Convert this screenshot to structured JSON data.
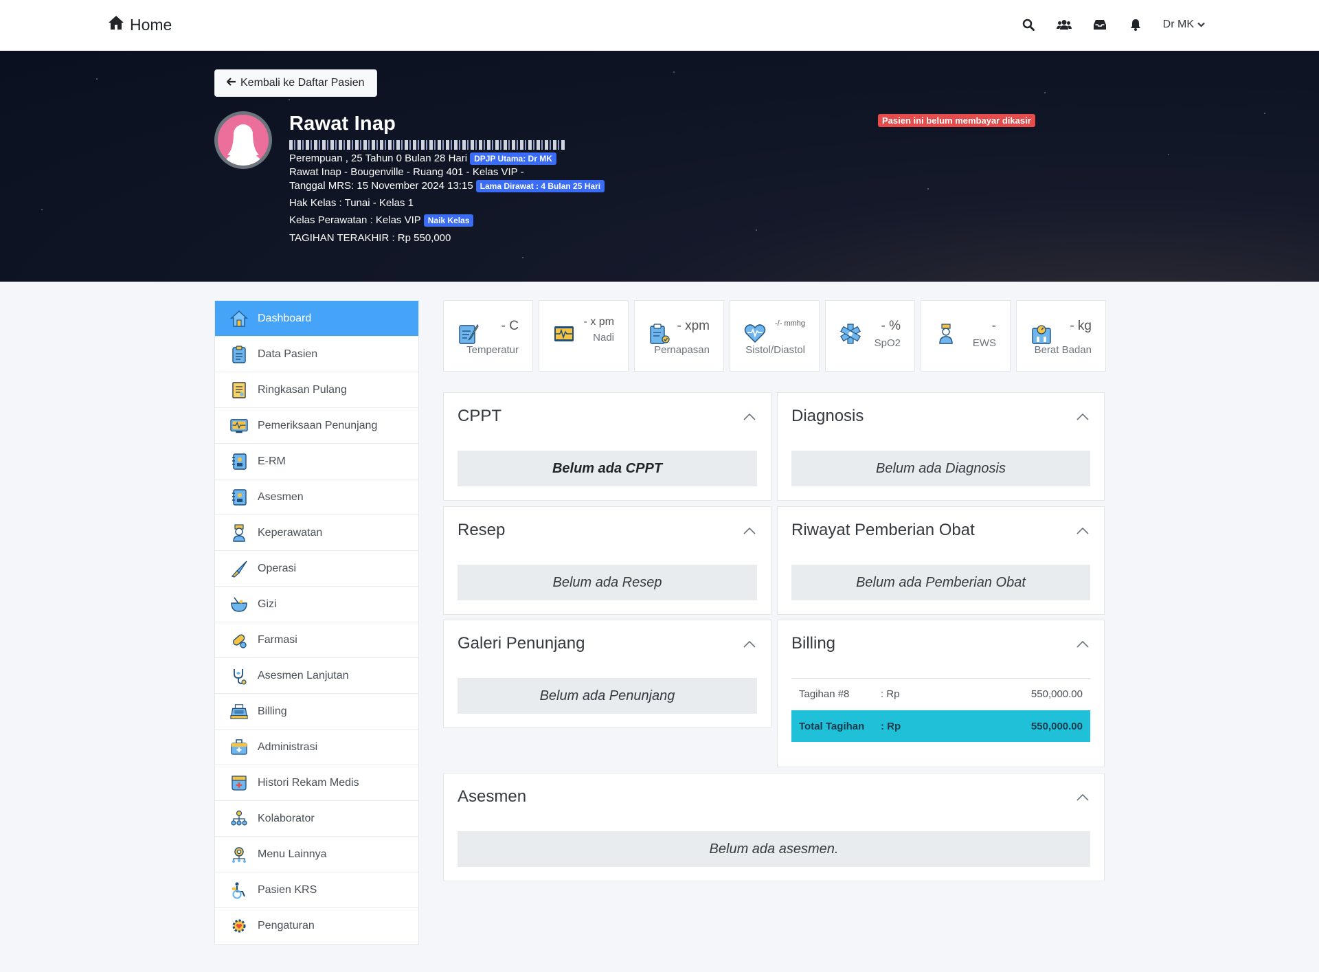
{
  "navbar": {
    "brand": "Home",
    "user": "Dr MK"
  },
  "hero": {
    "back_button": "Kembali ke Daftar Pasien",
    "title": "Rawat Inap",
    "gender_age": "Perempuan , 25 Tahun 0 Bulan 28 Hari",
    "dpjp_badge": "DPJP Utama: Dr MK",
    "room": "Rawat Inap - Bougenville - Ruang 401 - Kelas VIP -",
    "mrs_date": "Tanggal MRS: 15 November 2024 13:15",
    "length_badge": "Lama Dirawat : 4 Bulan 25 Hari",
    "hak_kelas": "Hak Kelas : Tunai - Kelas 1",
    "kelas_perawatan": "Kelas Perawatan : Kelas VIP",
    "naik_kelas_badge": "Naik Kelas",
    "tagihan": "TAGIHAN TERAKHIR : Rp 550,000",
    "alert": "Pasien ini belum membayar dikasir"
  },
  "sidebar": {
    "items": [
      {
        "label": "Dashboard",
        "icon": "home-icon"
      },
      {
        "label": "Data Pasien",
        "icon": "clipboard-icon"
      },
      {
        "label": "Ringkasan Pulang",
        "icon": "document-icon"
      },
      {
        "label": "Pemeriksaan Penunjang",
        "icon": "monitor-icon"
      },
      {
        "label": "E-RM",
        "icon": "notebook-icon"
      },
      {
        "label": "Asesmen",
        "icon": "notebook-icon"
      },
      {
        "label": "Keperawatan",
        "icon": "nurse-icon"
      },
      {
        "label": "Operasi",
        "icon": "scalpel-icon"
      },
      {
        "label": "Gizi",
        "icon": "bowl-icon"
      },
      {
        "label": "Farmasi",
        "icon": "pill-icon"
      },
      {
        "label": "Asesmen Lanjutan",
        "icon": "stethoscope-icon"
      },
      {
        "label": "Billing",
        "icon": "cash-register-icon"
      },
      {
        "label": "Administrasi",
        "icon": "medical-kit-icon"
      },
      {
        "label": "Histori Rekam Medis",
        "icon": "medical-box-icon"
      },
      {
        "label": "Kolaborator",
        "icon": "team-icon"
      },
      {
        "label": "Menu Lainnya",
        "icon": "gear-network-icon"
      },
      {
        "label": "Pasien KRS",
        "icon": "wheelchair-icon"
      },
      {
        "label": "Pengaturan",
        "icon": "settings-icon"
      }
    ]
  },
  "vitals": [
    {
      "value": "- C",
      "label": "Temperatur",
      "icon": "thermometer-icon"
    },
    {
      "value": "- x pm",
      "label": "Nadi",
      "icon": "pulse-monitor-icon"
    },
    {
      "value": "- xpm",
      "label": "Pernapasan",
      "icon": "clipboard-lung-icon"
    },
    {
      "value": "-/- mmhg",
      "label": "Sistol/Diastol",
      "icon": "heart-icon"
    },
    {
      "value": "- %",
      "label": "SpO2",
      "icon": "medical-star-icon"
    },
    {
      "value": "-",
      "label": "EWS",
      "icon": "nurse-icon"
    },
    {
      "value": "- kg",
      "label": "Berat Badan",
      "icon": "scale-icon"
    }
  ],
  "cards": {
    "cppt": {
      "title": "CPPT",
      "empty": "Belum ada CPPT"
    },
    "diagnosis": {
      "title": "Diagnosis",
      "empty": "Belum ada Diagnosis"
    },
    "resep": {
      "title": "Resep",
      "empty": "Belum ada Resep"
    },
    "obat": {
      "title": "Riwayat Pemberian Obat",
      "empty": "Belum ada Pemberian Obat"
    },
    "galeri": {
      "title": "Galeri Penunjang",
      "empty": "Belum ada Penunjang"
    },
    "billing": {
      "title": "Billing",
      "row": {
        "label": "Tagihan #8",
        "currency": ": Rp",
        "amount": "550,000.00"
      },
      "total": {
        "label": "Total Tagihan",
        "currency": ": Rp",
        "amount": "550,000.00"
      }
    },
    "asesmen": {
      "title": "Asesmen",
      "empty": "Belum ada asesmen."
    }
  }
}
